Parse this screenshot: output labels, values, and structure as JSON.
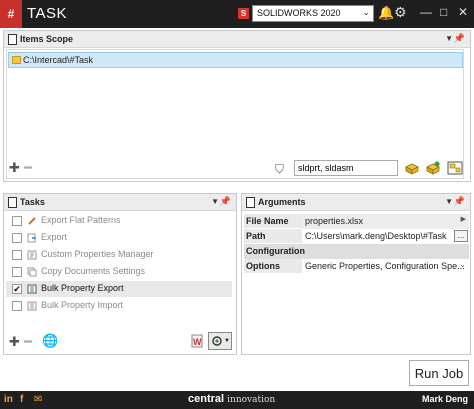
{
  "titlebar": {
    "app_title": "TASK",
    "cad_version": "SOLIDWORKS 2020",
    "minimize": "—",
    "maximize": "□",
    "close": "✕"
  },
  "items_scope": {
    "title": "Items Scope",
    "items": [
      "C:\\Intercad\\#Task"
    ],
    "filter_value": "sldprt, sldasm"
  },
  "tasks": {
    "title": "Tasks",
    "items": [
      {
        "label": "Export Flat Patterns",
        "checked": false
      },
      {
        "label": "Export",
        "checked": false
      },
      {
        "label": "Custom Properties Manager",
        "checked": false
      },
      {
        "label": "Copy Documents Settings",
        "checked": false
      },
      {
        "label": "Bulk Property Export",
        "checked": true
      },
      {
        "label": "Bulk Property Import",
        "checked": false
      }
    ]
  },
  "arguments": {
    "title": "Arguments",
    "rows": [
      {
        "key": "File Name",
        "value": "properties.xlsx"
      },
      {
        "key": "Path",
        "value": "C:\\Users\\mark.deng\\Desktop\\#Task"
      },
      {
        "key": "Configuration",
        "value": ""
      },
      {
        "key": "Options",
        "value": "Generic Properties, Configuration Spe..."
      }
    ],
    "ellipsis": "..."
  },
  "run_button": "Run Job",
  "footer": {
    "brand_bold": "central",
    "brand_light": "innovation",
    "user": "Mark Deng",
    "social": [
      "in",
      "f",
      "✉"
    ]
  },
  "colors": {
    "titlebar_bg": "#1f1f1f",
    "logo_red": "#c9302c",
    "selection_blue": "#cfe8f7",
    "bell_yellow": "#f0c419"
  }
}
